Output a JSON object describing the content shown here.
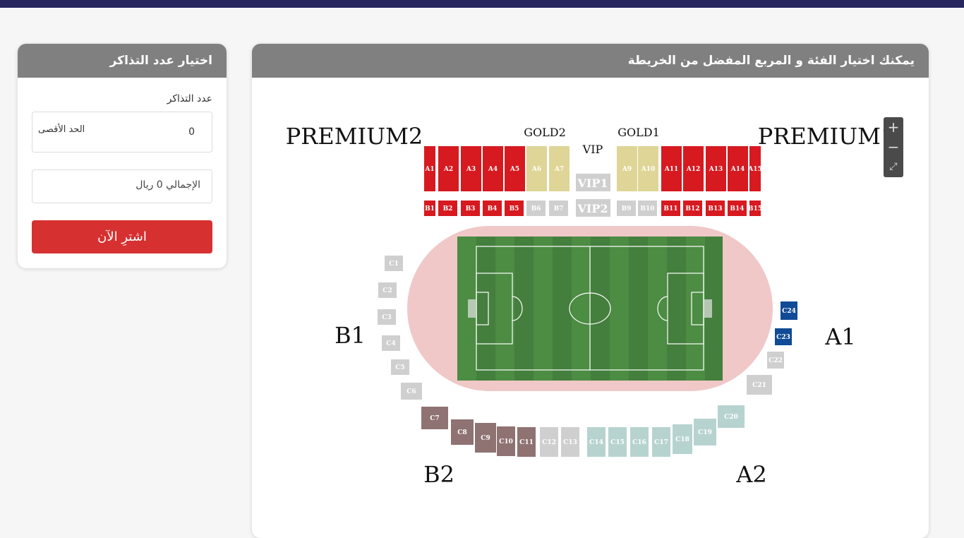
{
  "colors": {
    "topbar": "#27265f",
    "header": "#808080",
    "buy": "#d63031",
    "premium": "#d71920",
    "gold": "#dfd596",
    "grey": "#cfcfcf",
    "mauve": "#8f7272",
    "lightblue": "#b7d3d0",
    "blue": "#114a96",
    "pitch": "#447f3d",
    "track": "#f0c8c8"
  },
  "sidebar": {
    "title": "اختيار عدد التذاكر",
    "tickets_label": "عدد التذاكر",
    "quantity": "0",
    "max_label": "الحد الأقصى",
    "total": "الإجمالي 0 ريال",
    "buy_label": "اشترِ الآن"
  },
  "map": {
    "title": "يمكنك اختيار الفئة و المربع المفضل من الخريطة",
    "zones": {
      "premium2": "PREMIUM2",
      "premium1": "PREMIUM1",
      "gold2": "GOLD2",
      "gold1": "GOLD1",
      "vip": "VIP",
      "vip1": "VIP1",
      "vip2": "VIP2",
      "b1": "B1",
      "b2": "B2",
      "a1": "A1",
      "a2": "A2"
    },
    "a_blocks": [
      "A1",
      "A2",
      "A3",
      "A4",
      "A5",
      "A6",
      "A7",
      "A9",
      "A10",
      "A11",
      "A12",
      "A13",
      "A14",
      "A15"
    ],
    "b_blocks": [
      "B1",
      "B2",
      "B3",
      "B4",
      "B5",
      "B6",
      "B7",
      "B9",
      "B10",
      "B11",
      "B12",
      "B13",
      "B14",
      "B15"
    ],
    "c_blocks": [
      "C1",
      "C2",
      "C3",
      "C4",
      "C5",
      "C6",
      "C7",
      "C8",
      "C9",
      "C10",
      "C11",
      "C12",
      "C13",
      "C14",
      "C15",
      "C16",
      "C17",
      "C18",
      "C19",
      "C20",
      "C21",
      "C22",
      "C23",
      "C24"
    ],
    "zoom": {
      "in_icon": "plus-icon",
      "out_icon": "minus-icon",
      "full_icon": "fullscreen-icon"
    }
  }
}
